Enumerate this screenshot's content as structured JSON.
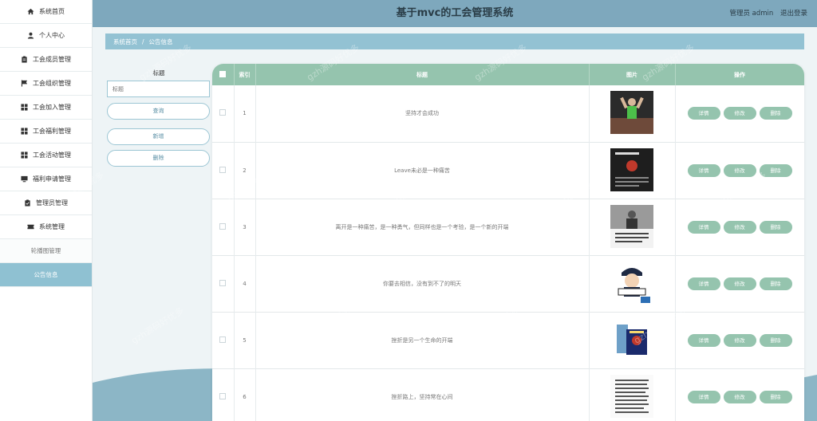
{
  "header": {
    "title": "基于mvc的工会管理系统",
    "user_label": "管理员 admin",
    "logout": "退出登录"
  },
  "sidebar": {
    "items": [
      {
        "label": "系统首页",
        "icon": "home-icon"
      },
      {
        "label": "个人中心",
        "icon": "user-icon"
      },
      {
        "label": "工会成员管理",
        "icon": "clipboard-icon"
      },
      {
        "label": "工会组织管理",
        "icon": "flag-icon"
      },
      {
        "label": "工会加入管理",
        "icon": "grid-icon"
      },
      {
        "label": "工会福利管理",
        "icon": "grid-icon"
      },
      {
        "label": "工会活动管理",
        "icon": "grid-icon"
      },
      {
        "label": "福利申请管理",
        "icon": "monitor-icon"
      },
      {
        "label": "管理员管理",
        "icon": "clipboard-check-icon"
      },
      {
        "label": "系统管理",
        "icon": "ticket-icon"
      }
    ],
    "sub_items": [
      {
        "label": "轮播图管理"
      },
      {
        "label": "公告信息"
      }
    ]
  },
  "breadcrumb": {
    "home": "系统首页",
    "separator": "/",
    "current": "公告信息"
  },
  "search": {
    "field_label": "标题",
    "placeholder": "标题",
    "query_button": "查询",
    "add_button": "新增",
    "delete_button": "删除"
  },
  "table": {
    "headers": {
      "index": "索引",
      "title": "标题",
      "image": "图片",
      "actions": "操作"
    },
    "action_labels": {
      "detail": "详情",
      "edit": "修改",
      "delete": "删除"
    },
    "rows": [
      {
        "index": "1",
        "title": "坚持才会成功"
      },
      {
        "index": "2",
        "title": "Leave未必是一种痛苦"
      },
      {
        "index": "3",
        "title": "离开是一种痛苦，是一种勇气，但同样也是一个考验，是一个新的开端"
      },
      {
        "index": "4",
        "title": "你要去相信，没有到不了的明天"
      },
      {
        "index": "5",
        "title": "挫折是另一个生命的开端"
      },
      {
        "index": "6",
        "title": "挫折路上，坚持常在心间"
      }
    ]
  },
  "watermark": "gzh源码好优多",
  "colors": {
    "header_bg": "#7ea8bd",
    "accent": "#95c4ae",
    "breadcrumb_bg": "#93c2d3",
    "sidebar_active": "#8fc1d2"
  }
}
